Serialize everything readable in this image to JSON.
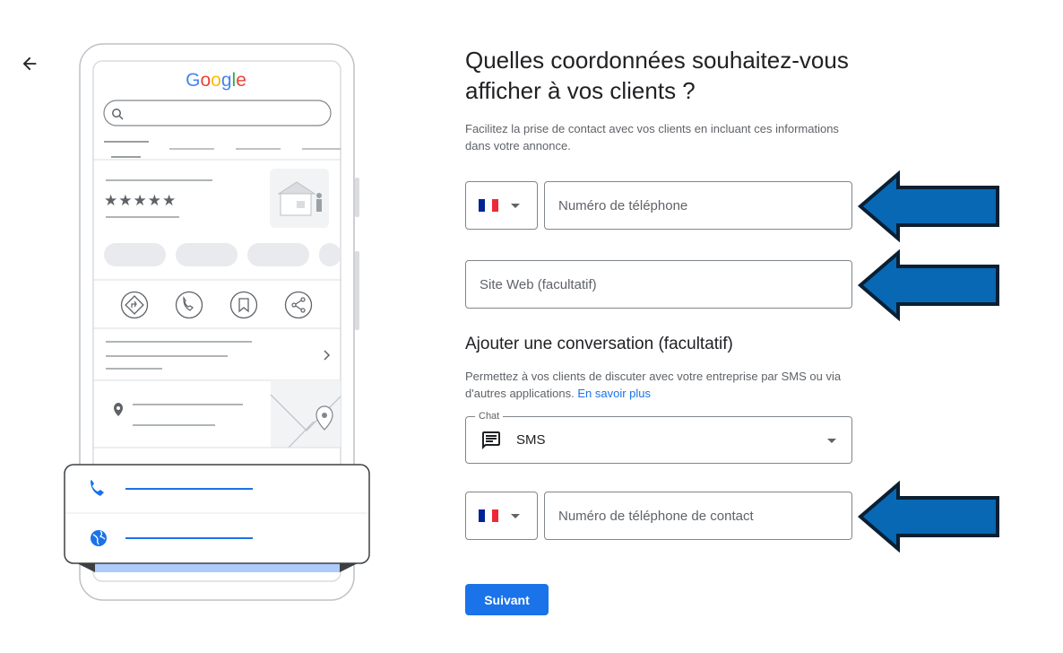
{
  "illustration": {
    "brand": "Google",
    "rating_stars": "★★★★★"
  },
  "form": {
    "title": "Quelles coordonnées souhaitez-vous afficher à vos clients ?",
    "description": "Facilitez la prise de contact avec vos clients en incluant ces informations dans votre annonce.",
    "phone_placeholder": "Numéro de téléphone",
    "website_placeholder": "Site Web (facultatif)",
    "chat_section_title": "Ajouter une conversation (facultatif)",
    "chat_description": "Permettez à vos clients de discuter avec votre entreprise par SMS ou via d'autres applications.",
    "learn_more": "En savoir plus",
    "chat_label": "Chat",
    "chat_value": "SMS",
    "contact_phone_placeholder": "Numéro de téléphone de contact",
    "next_button": "Suivant"
  },
  "colors": {
    "accent": "#1a73e8",
    "annotation_arrow": "#0868b4",
    "flag_blue": "#002395",
    "flag_white": "#ffffff",
    "flag_red": "#ed2939"
  }
}
